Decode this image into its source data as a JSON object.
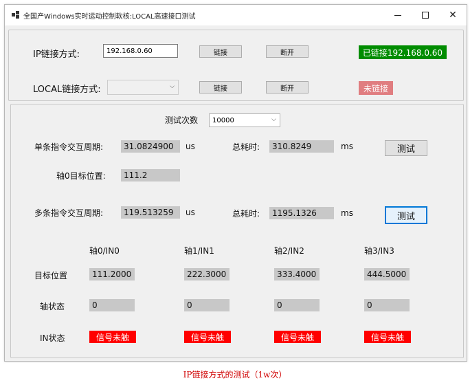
{
  "window": {
    "title": "全国产Windows实时运动控制软核:LOCAL高速接口测试",
    "controls": {
      "minimize": "—",
      "maximize": "□",
      "close": "✕"
    }
  },
  "connection": {
    "ip_label": "IP链接方式:",
    "ip_value": "192.168.0.60",
    "ip_connect": "链接",
    "ip_disconnect": "断开",
    "ip_status": "已链接192.168.0.60",
    "local_label": "LOCAL链接方式:",
    "local_value": "",
    "local_connect": "链接",
    "local_disconnect": "断开",
    "local_status": "未链接"
  },
  "test": {
    "count_label": "测试次数",
    "count_value": "10000",
    "single_cycle_label": "单条指令交互周期:",
    "single_cycle_value": "31.0824900",
    "single_cycle_unit": "us",
    "single_total_label": "总耗时:",
    "single_total_value": "310.8249",
    "single_total_unit": "ms",
    "single_test_button": "测试",
    "axis0_target_label": "轴0目标位置:",
    "axis0_target_value": "111.2",
    "multi_cycle_label": "多条指令交互周期:",
    "multi_cycle_value": "119.513259",
    "multi_cycle_unit": "us",
    "multi_total_label": "总耗时:",
    "multi_total_value": "1195.1326",
    "multi_total_unit": "ms",
    "multi_test_button": "测试"
  },
  "axes": {
    "headers": [
      "轴0/IN0",
      "轴1/IN1",
      "轴2/IN2",
      "轴3/IN3"
    ],
    "row_labels": {
      "target": "目标位置",
      "state": "轴状态",
      "in_state": "IN状态"
    },
    "targets": [
      "111.2000",
      "222.3000",
      "333.4000",
      "444.5000"
    ],
    "states": [
      "0",
      "0",
      "0",
      "0"
    ],
    "in_states": [
      "信号未触",
      "信号未触",
      "信号未触",
      "信号未触"
    ]
  },
  "caption": "IP链接方式的测试（1w次）",
  "colors": {
    "connected": "#008c00",
    "disconnected": "#e07d80",
    "signal": "#ff0000",
    "focus": "#0078d7"
  }
}
